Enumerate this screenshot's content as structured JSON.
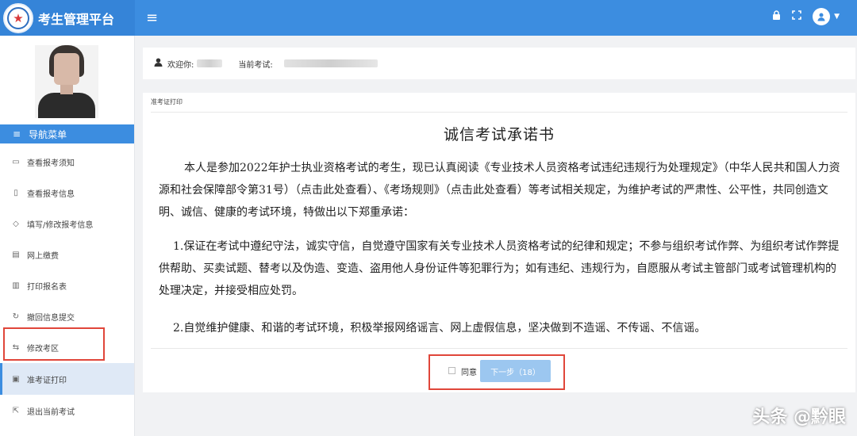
{
  "header": {
    "logo_icon": "star-emblem",
    "title": "考生管理平台",
    "menu_icon": "hamburger-icon",
    "icons": [
      "lock-icon",
      "fullscreen-icon",
      "user-avatar-icon"
    ]
  },
  "sidebar": {
    "nav_header": "导航菜单",
    "items": [
      {
        "label": "查看报考须知",
        "icon": "message-icon"
      },
      {
        "label": "查看报考信息",
        "icon": "document-icon"
      },
      {
        "label": "填写/修改报考信息",
        "icon": "shield-icon"
      },
      {
        "label": "网上缴费",
        "icon": "receipt-icon"
      },
      {
        "label": "打印报名表",
        "icon": "print-form-icon"
      },
      {
        "label": "撤回信息提交",
        "icon": "undo-icon"
      },
      {
        "label": "修改考区",
        "icon": "swap-icon"
      },
      {
        "label": "准考证打印",
        "icon": "id-card-icon",
        "active": true
      },
      {
        "label": "退出当前考试",
        "icon": "exit-icon"
      }
    ]
  },
  "welcome_bar": {
    "welcome_label": "欢迎你:",
    "current_exam_label": "当前考试:"
  },
  "card": {
    "tab_label": "准考证打印",
    "title": "诚信考试承诺书",
    "paragraph1": "本人是参加2022年护士执业资格考试的考生，现已认真阅读《专业技术人员资格考试违纪违规行为处理规定》（中华人民共和国人力资源和社会保障部令第31号）（点击此处查看）、《考场规则》（点击此处查看）等考试相关规定，为维护考试的严肃性、公平性，共同创造文明、诚信、健康的考试环境，特做出以下郑重承诺：",
    "paragraph2": "1.保证在考试中遵纪守法，诚实守信，自觉遵守国家有关专业技术人员资格考试的纪律和规定；不参与组织考试作弊、为组织考试作弊提供帮助、买卖试题、替考以及伪造、变造、盗用他人身份证件等犯罪行为；如有违纪、违规行为，自愿服从考试主管部门或考试管理机构的处理决定，并接受相应处罚。",
    "paragraph3": "2.自觉维护健康、和谐的考试环境，积极举报网络谣言、网上虚假信息，坚决做到不造谣、不传谣、不信谣。",
    "agree_label": "同意",
    "agree_checked": false,
    "next_button": "下一步（18）"
  },
  "watermark": "头条 @黔眼",
  "colors": {
    "primary": "#3c8de0",
    "active_bg": "#dfe9f6",
    "highlight_border": "#e0463a",
    "disabled_button": "#9cc7f0"
  }
}
